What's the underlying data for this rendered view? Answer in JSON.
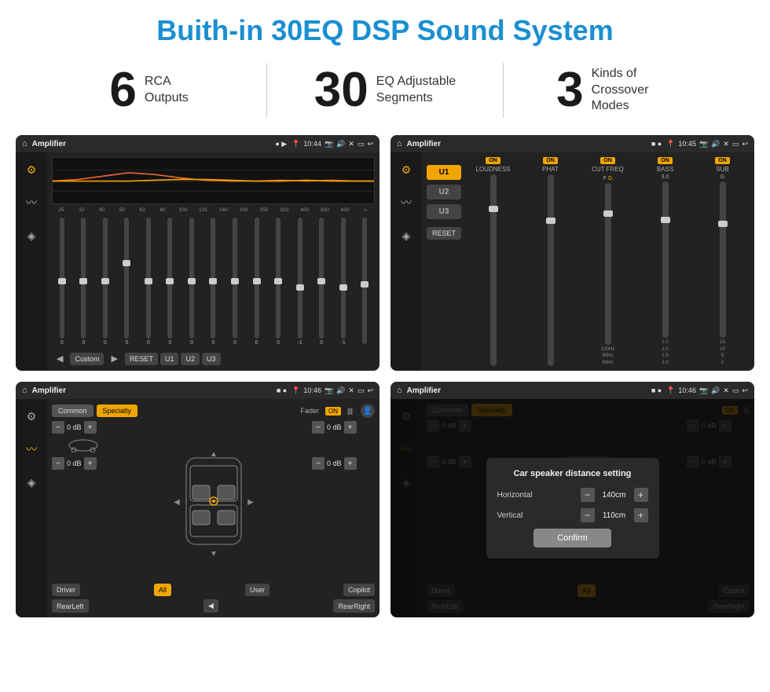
{
  "page": {
    "title": "Buith-in 30EQ DSP Sound System"
  },
  "stats": [
    {
      "number": "6",
      "text1": "RCA",
      "text2": "Outputs"
    },
    {
      "number": "30",
      "text1": "EQ Adjustable",
      "text2": "Segments"
    },
    {
      "number": "3",
      "text1": "Kinds of",
      "text2": "Crossover Modes"
    }
  ],
  "screens": [
    {
      "id": "eq-screen",
      "status_bar": {
        "title": "Amplifier",
        "time": "10:44"
      }
    },
    {
      "id": "crossover-screen",
      "status_bar": {
        "title": "Amplifier",
        "time": "10:45"
      }
    },
    {
      "id": "fader-screen",
      "status_bar": {
        "title": "Amplifier",
        "time": "10:46"
      }
    },
    {
      "id": "dialog-screen",
      "status_bar": {
        "title": "Amplifier",
        "time": "10:46"
      },
      "dialog": {
        "title": "Car speaker distance setting",
        "horizontal_label": "Horizontal",
        "horizontal_value": "140cm",
        "vertical_label": "Vertical",
        "vertical_value": "110cm",
        "confirm_label": "Confirm"
      }
    }
  ],
  "eq": {
    "freqs": [
      "25",
      "32",
      "40",
      "50",
      "63",
      "80",
      "100",
      "125",
      "160",
      "200",
      "250",
      "320",
      "400",
      "500",
      "630"
    ],
    "values": [
      "0",
      "0",
      "0",
      "5",
      "0",
      "0",
      "0",
      "0",
      "0",
      "0",
      "0",
      "-1",
      "0",
      "-1",
      ""
    ],
    "presets": [
      "Custom",
      "RESET",
      "U1",
      "U2",
      "U3"
    ]
  },
  "crossover": {
    "u_buttons": [
      "U1",
      "U2",
      "U3"
    ],
    "channels": [
      "LOUDNESS",
      "PHAT",
      "CUT FREQ",
      "BASS",
      "SUB"
    ],
    "reset_label": "RESET"
  },
  "fader": {
    "tabs": [
      "Common",
      "Specialty"
    ],
    "fader_label": "Fader",
    "on_label": "ON",
    "db_values": [
      "0 dB",
      "0 dB",
      "0 dB",
      "0 dB"
    ],
    "bottom_btns": [
      "Driver",
      "All",
      "User",
      "Copilot",
      "RearLeft",
      "RearRight"
    ]
  }
}
